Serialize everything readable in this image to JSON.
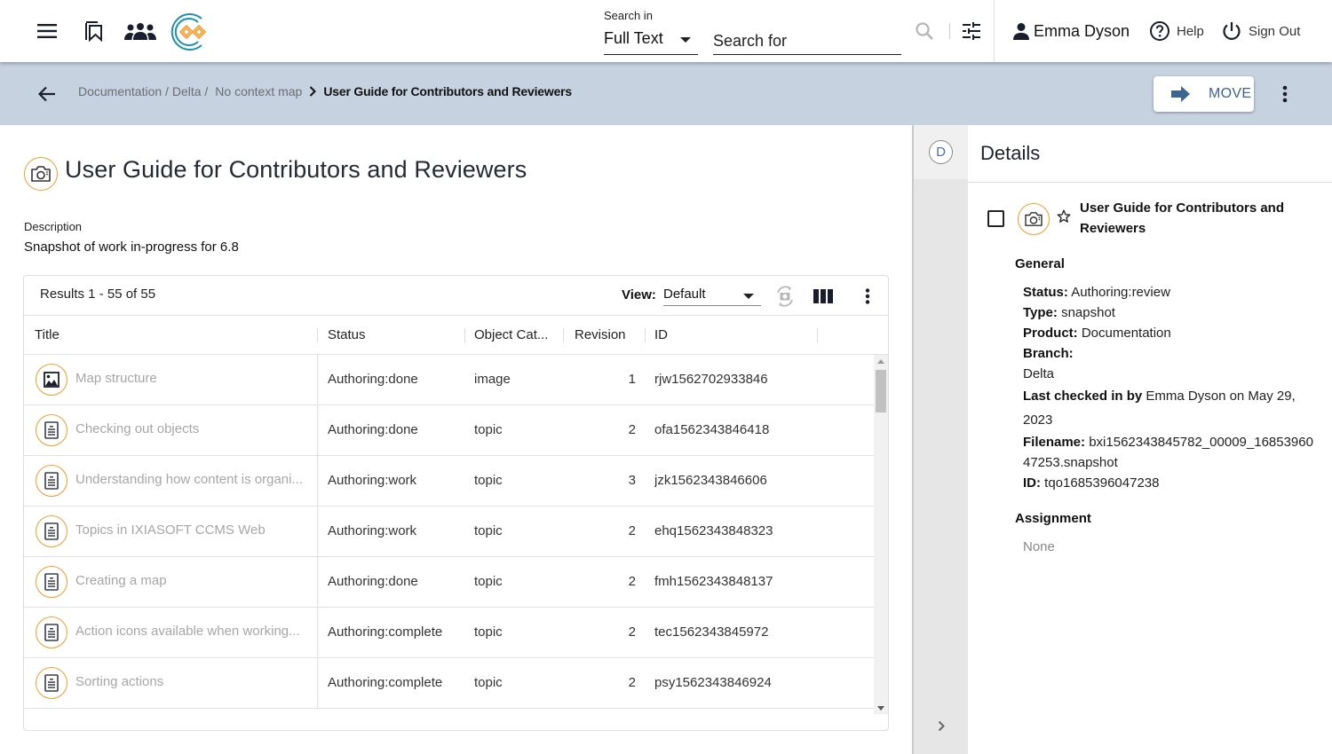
{
  "topbar": {
    "search_in_label": "Search in",
    "search_in_value": "Full Text",
    "search_placeholder": "Search for",
    "user_name": "Emma Dyson",
    "help_label": "Help",
    "signout_label": "Sign Out",
    "icons": [
      "menu-icon",
      "bookmark-icon",
      "groups-icon",
      "logo",
      "search-icon",
      "filter-sliders-icon",
      "person-icon",
      "help-circle-icon",
      "power-icon"
    ]
  },
  "breadcrumb": {
    "path": "Documentation / Delta /",
    "context": "No context map",
    "current": "User Guide for Contributors and Reviewers"
  },
  "actions": {
    "move_label": "MOVE"
  },
  "page": {
    "title": "User Guide for Contributors and Reviewers",
    "description_label": "Description",
    "description": "Snapshot of work in-progress for 6.8"
  },
  "results": {
    "count_text": "Results 1 - 55 of 55",
    "view_label": "View:",
    "view_value": "Default",
    "columns": [
      "Title",
      "Status",
      "Object Cat...",
      "Revision",
      "ID"
    ],
    "rows": [
      {
        "icon": "image",
        "title": "Map structure",
        "status": "Authoring:done",
        "category": "image",
        "revision": "1",
        "id": "rjw1562702933846"
      },
      {
        "icon": "topic",
        "title": "Checking out objects",
        "status": "Authoring:done",
        "category": "topic",
        "revision": "2",
        "id": "ofa1562343846418"
      },
      {
        "icon": "topic",
        "title": "Understanding how content is organi...",
        "status": "Authoring:work",
        "category": "topic",
        "revision": "3",
        "id": "jzk1562343846606"
      },
      {
        "icon": "topic",
        "title": "Topics in IXIASOFT CCMS Web",
        "status": "Authoring:work",
        "category": "topic",
        "revision": "2",
        "id": "ehq1562343848323"
      },
      {
        "icon": "topic",
        "title": "Creating a map",
        "status": "Authoring:done",
        "category": "topic",
        "revision": "2",
        "id": "fmh1562343848137"
      },
      {
        "icon": "topic",
        "title": "Action icons available when working...",
        "status": "Authoring:complete",
        "category": "topic",
        "revision": "2",
        "id": "tec1562343845972"
      },
      {
        "icon": "topic",
        "title": "Sorting actions",
        "status": "Authoring:complete",
        "category": "topic",
        "revision": "2",
        "id": "psy1562343846924"
      }
    ]
  },
  "rail": {
    "badge": "D"
  },
  "details": {
    "title": "Details",
    "object_name": "User Guide for Contributors and Reviewers",
    "general_title": "General",
    "status_label": "Status:",
    "status_value": "Authoring:review",
    "type_label": "Type:",
    "type_value": "snapshot",
    "product_label": "Product:",
    "product_value": "Documentation",
    "branch_label": "Branch:",
    "branch_value": "Delta",
    "checked_label": "Last checked in by",
    "checked_value": "Emma Dyson on May 29, 2023",
    "filename_label": "Filename:",
    "filename_value": "bxi1562343845782_00009_1685396047253.snapshot",
    "id_label": "ID:",
    "id_value": "tqo1685396047238",
    "assignment_title": "Assignment",
    "assignment_value": "None"
  },
  "colors": {
    "accent_orange": "#f39c2b",
    "subheader_bg": "#c6d2e0",
    "move_blue": "#3e6490"
  }
}
